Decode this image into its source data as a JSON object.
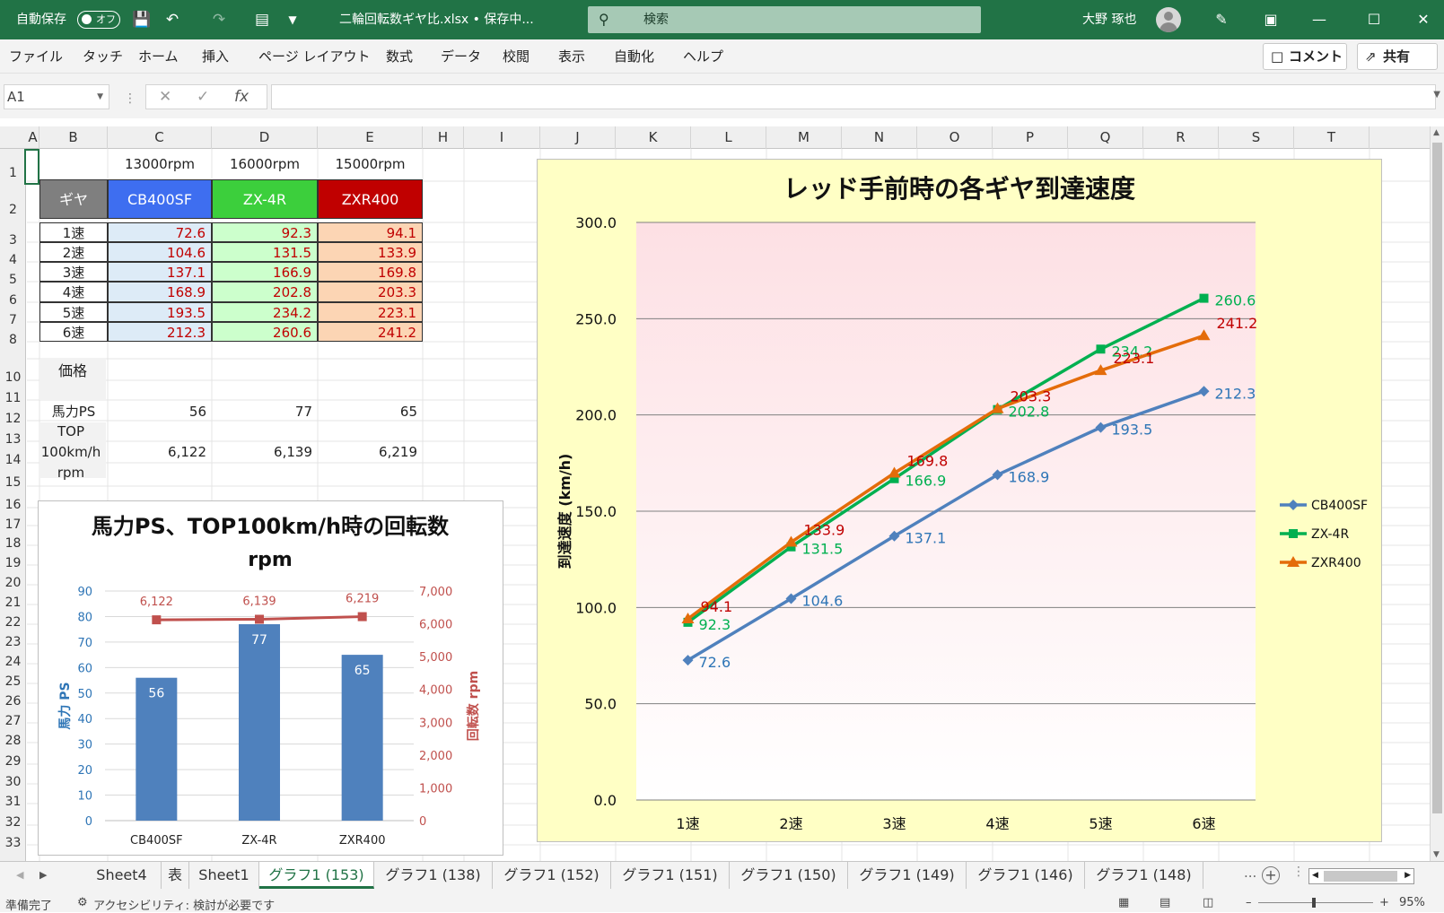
{
  "titlebar": {
    "autosave_label": "自動保存",
    "autosave_state": "オフ",
    "filename": "二輪回転数ギヤ比.xlsx • 保存中...",
    "search_placeholder": "検索",
    "user_name": "大野 琢也"
  },
  "menu": [
    "ファイル",
    "タッチ",
    "ホーム",
    "挿入",
    "ページ レイアウト",
    "数式",
    "データ",
    "校閲",
    "表示",
    "自動化",
    "ヘルプ"
  ],
  "ribbon_buttons": {
    "comment": "コメント",
    "share": "共有"
  },
  "formula_bar": {
    "name_box": "A1",
    "fx": "fx",
    "formula": ""
  },
  "columns": [
    {
      "l": "A",
      "w": 14
    },
    {
      "l": "B",
      "w": 76
    },
    {
      "l": "C",
      "w": 116
    },
    {
      "l": "D",
      "w": 118
    },
    {
      "l": "E",
      "w": 117
    },
    {
      "l": "H",
      "w": 46
    },
    {
      "l": "I",
      "w": 85
    },
    {
      "l": "J",
      "w": 84
    },
    {
      "l": "K",
      "w": 84
    },
    {
      "l": "L",
      "w": 84
    },
    {
      "l": "M",
      "w": 84
    },
    {
      "l": "N",
      "w": 84
    },
    {
      "l": "O",
      "w": 84
    },
    {
      "l": "P",
      "w": 84
    },
    {
      "l": "Q",
      "w": 84
    },
    {
      "l": "R",
      "w": 84
    },
    {
      "l": "S",
      "w": 84
    },
    {
      "l": "T",
      "w": 84
    }
  ],
  "rows": [
    "1",
    "2",
    "3",
    "4",
    "5",
    "6",
    "7",
    "8",
    "",
    "10",
    "11",
    "12",
    "13",
    "14",
    "15",
    "16",
    "17",
    "18",
    "19",
    "20",
    "21",
    "22",
    "23",
    "24",
    "25",
    "26",
    "27",
    "28",
    "29",
    "30",
    "31",
    "32",
    "33"
  ],
  "table": {
    "rpm": [
      "13000rpm",
      "16000rpm",
      "15000rpm"
    ],
    "header": [
      "ギヤ",
      "CB400SF",
      "ZX-4R",
      "ZXR400"
    ],
    "header_colors": [
      "#7f7f7f",
      "#3e6ef0",
      "#3ccf3c",
      "#c00000"
    ],
    "col_bg": [
      "#ddebf7",
      "#ccffcc",
      "#fcd5b4"
    ],
    "gears": [
      "1速",
      "2速",
      "3速",
      "4速",
      "5速",
      "6速"
    ],
    "values": [
      [
        "72.6",
        "92.3",
        "94.1"
      ],
      [
        "104.6",
        "131.5",
        "133.9"
      ],
      [
        "137.1",
        "166.9",
        "169.8"
      ],
      [
        "168.9",
        "202.8",
        "203.3"
      ],
      [
        "193.5",
        "234.2",
        "223.1"
      ],
      [
        "212.3",
        "260.6",
        "241.2"
      ]
    ],
    "price_label": "価格",
    "hp_label": "馬力PS",
    "hp_values": [
      "56",
      "77",
      "65"
    ],
    "top_label": [
      "TOP",
      "100km/h",
      "rpm"
    ],
    "top_values": [
      "6,122",
      "6,139",
      "6,219"
    ]
  },
  "chart_data": [
    {
      "type": "bar",
      "title": "馬力PS、TOP100km/h時の回転数",
      "subtitle": "rpm",
      "categories": [
        "CB400SF",
        "ZX-4R",
        "ZXR400"
      ],
      "series": [
        {
          "name": "馬力 PS",
          "kind": "bar",
          "axis": "left",
          "values": [
            56,
            77,
            65
          ],
          "color": "#4f81bd"
        },
        {
          "name": "回転数 rpm",
          "kind": "line",
          "axis": "right",
          "values": [
            6122,
            6139,
            6219
          ],
          "labels": [
            "6,122",
            "6,139",
            "6,219"
          ],
          "color": "#c0504d"
        }
      ],
      "ylabel": "馬力 PS",
      "y2label": "回転数 rpm",
      "ylim": [
        0,
        90
      ],
      "yticks": [
        "0",
        "10",
        "20",
        "30",
        "40",
        "50",
        "60",
        "70",
        "80",
        "90"
      ],
      "y2lim": [
        0,
        7000
      ],
      "y2ticks": [
        "0",
        "1,000",
        "2,000",
        "3,000",
        "4,000",
        "5,000",
        "6,000",
        "7,000"
      ],
      "grid": true,
      "legend": "none"
    },
    {
      "type": "line",
      "title": "レッド手前時の各ギヤ到達速度",
      "categories": [
        "1速",
        "2速",
        "3速",
        "4速",
        "5速",
        "6速"
      ],
      "series": [
        {
          "name": "CB400SF",
          "values": [
            72.6,
            104.6,
            137.1,
            168.9,
            193.5,
            212.3
          ],
          "color": "#4f81bd",
          "label_color": "#2e75b6",
          "marker": "diamond"
        },
        {
          "name": "ZX-4R",
          "values": [
            92.3,
            131.5,
            166.9,
            202.8,
            234.2,
            260.6
          ],
          "color": "#00b050",
          "label_color": "#00b050",
          "marker": "square"
        },
        {
          "name": "ZXR400",
          "values": [
            94.1,
            133.9,
            169.8,
            203.3,
            223.1,
            241.2
          ],
          "color": "#e46c0a",
          "label_color": "#c00000",
          "marker": "triangle"
        }
      ],
      "ylabel": "到達速度 (km/h)",
      "ylim": [
        0,
        300
      ],
      "yticks": [
        "0.0",
        "50.0",
        "100.0",
        "150.0",
        "200.0",
        "250.0",
        "300.0"
      ],
      "grid": true,
      "legend": "right"
    }
  ],
  "sheet_tabs": [
    "Sheet4",
    "表",
    "Sheet1",
    "グラフ1 (153)",
    "グラフ1 (138)",
    "グラフ1 (152)",
    "グラフ1 (151)",
    "グラフ1 (150)",
    "グラフ1 (149)",
    "グラフ1 (146)",
    "グラフ1 (148)"
  ],
  "active_tab": "グラフ1 (153)",
  "tabs_more": "...",
  "status": {
    "ready": "準備完了",
    "accessibility": "アクセシビリティ: 検討が必要です",
    "zoom": "95%"
  },
  "colors": {
    "excel_green": "#217346",
    "chart_bg": "#ffffc5",
    "plot_top": "#fde0e4"
  },
  "icons": [
    "save-icon",
    "undo-icon",
    "redo-icon",
    "touch-mode-icon",
    "customize-icon",
    "search-icon",
    "pen-icon",
    "ribbon-display-icon",
    "minimize-icon",
    "maximize-icon",
    "close-icon",
    "comment-icon",
    "share-icon",
    "cancel-icon",
    "enter-icon",
    "fx-icon",
    "scroll-left-icon",
    "scroll-right-icon",
    "add-sheet-icon",
    "normal-view-icon",
    "page-layout-icon",
    "page-break-icon",
    "accessibility-icon"
  ]
}
